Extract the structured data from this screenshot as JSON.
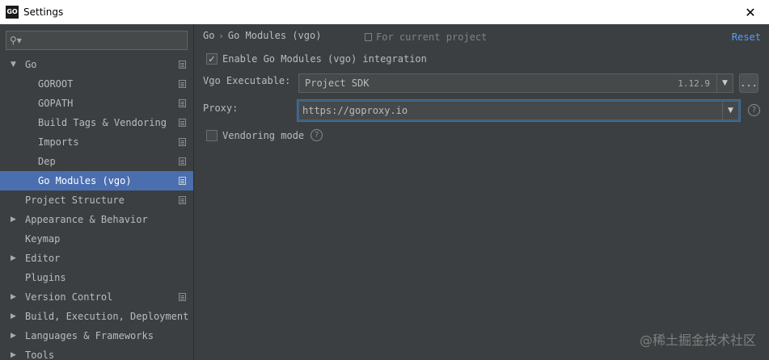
{
  "window": {
    "app_icon_text": "GO",
    "title": "Settings",
    "close_glyph": "✕"
  },
  "sidebar": {
    "search": {
      "value": "",
      "placeholder": "",
      "icon": "search-icon"
    },
    "items": [
      {
        "label": "Go",
        "level": 0,
        "expanded": true,
        "has_arrow": true,
        "project_icon": true,
        "selected": false
      },
      {
        "label": "GOROOT",
        "level": 1,
        "has_arrow": false,
        "project_icon": true,
        "selected": false
      },
      {
        "label": "GOPATH",
        "level": 1,
        "has_arrow": false,
        "project_icon": true,
        "selected": false
      },
      {
        "label": "Build Tags & Vendoring",
        "level": 1,
        "has_arrow": false,
        "project_icon": true,
        "selected": false
      },
      {
        "label": "Imports",
        "level": 1,
        "has_arrow": false,
        "project_icon": true,
        "selected": false
      },
      {
        "label": "Dep",
        "level": 1,
        "has_arrow": false,
        "project_icon": true,
        "selected": false
      },
      {
        "label": "Go Modules (vgo)",
        "level": 1,
        "has_arrow": false,
        "project_icon": true,
        "selected": true
      },
      {
        "label": "Project Structure",
        "level": 0,
        "has_arrow": false,
        "project_icon": true,
        "selected": false
      },
      {
        "label": "Appearance & Behavior",
        "level": 0,
        "has_arrow": true,
        "expanded": false,
        "project_icon": false,
        "selected": false
      },
      {
        "label": "Keymap",
        "level": 0,
        "has_arrow": false,
        "project_icon": false,
        "selected": false
      },
      {
        "label": "Editor",
        "level": 0,
        "has_arrow": true,
        "expanded": false,
        "project_icon": false,
        "selected": false
      },
      {
        "label": "Plugins",
        "level": 0,
        "has_arrow": false,
        "project_icon": false,
        "selected": false
      },
      {
        "label": "Version Control",
        "level": 0,
        "has_arrow": true,
        "expanded": false,
        "project_icon": true,
        "selected": false
      },
      {
        "label": "Build, Execution, Deployment",
        "level": 0,
        "has_arrow": true,
        "expanded": false,
        "project_icon": false,
        "selected": false
      },
      {
        "label": "Languages & Frameworks",
        "level": 0,
        "has_arrow": true,
        "expanded": false,
        "project_icon": false,
        "selected": false
      },
      {
        "label": "Tools",
        "level": 0,
        "has_arrow": true,
        "expanded": false,
        "project_icon": false,
        "selected": false
      }
    ]
  },
  "main": {
    "breadcrumb": [
      "Go",
      "Go Modules (vgo)"
    ],
    "scope_label": "For current project",
    "reset_label": "Reset",
    "enable_checkbox": {
      "label": "Enable Go Modules (vgo) integration",
      "checked": true
    },
    "vgo_executable": {
      "label": "Vgo Executable:",
      "value": "Project SDK",
      "version": "1.12.9",
      "browse_label": "..."
    },
    "proxy": {
      "label": "Proxy:",
      "value": "https://goproxy.io"
    },
    "vendoring_checkbox": {
      "label": "Vendoring mode",
      "checked": false
    },
    "help_glyph": "?"
  },
  "watermark": "@稀土掘金技术社区",
  "colors": {
    "background": "#3c3f41",
    "selection": "#4b6eaf",
    "link": "#589df6",
    "text": "#bbbbbb"
  }
}
